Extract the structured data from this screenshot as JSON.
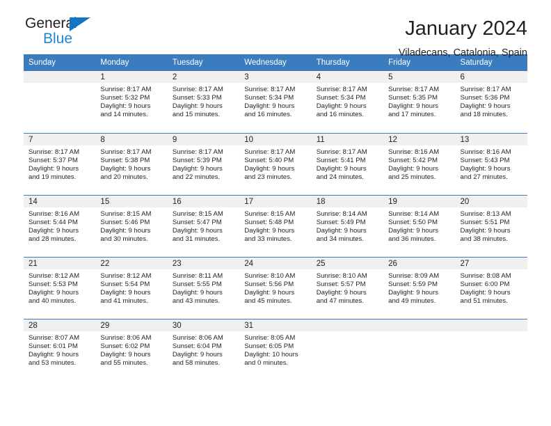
{
  "brand": {
    "name_top": "General",
    "name_bottom": "Blue",
    "triangle_icon": "triangle-icon",
    "accent_color": "#1275c4",
    "blue_text_color": "#1b87d8"
  },
  "header": {
    "title": "January 2024",
    "subtitle": "Viladecans, Catalonia, Spain"
  },
  "theme": {
    "header_row_bg": "#3b7cbe",
    "daynum_band_bg": "#f0f0f0",
    "row_border": "#3b7cbe",
    "text": "#231f20"
  },
  "calendar": {
    "weekday_headers": [
      "Sunday",
      "Monday",
      "Tuesday",
      "Wednesday",
      "Thursday",
      "Friday",
      "Saturday"
    ],
    "weeks": [
      [
        {
          "day": "",
          "sunrise": "",
          "sunset": "",
          "daylight_line1": "",
          "daylight_line2": ""
        },
        {
          "day": "1",
          "sunrise": "Sunrise: 8:17 AM",
          "sunset": "Sunset: 5:32 PM",
          "daylight_line1": "Daylight: 9 hours",
          "daylight_line2": "and 14 minutes."
        },
        {
          "day": "2",
          "sunrise": "Sunrise: 8:17 AM",
          "sunset": "Sunset: 5:33 PM",
          "daylight_line1": "Daylight: 9 hours",
          "daylight_line2": "and 15 minutes."
        },
        {
          "day": "3",
          "sunrise": "Sunrise: 8:17 AM",
          "sunset": "Sunset: 5:34 PM",
          "daylight_line1": "Daylight: 9 hours",
          "daylight_line2": "and 16 minutes."
        },
        {
          "day": "4",
          "sunrise": "Sunrise: 8:17 AM",
          "sunset": "Sunset: 5:34 PM",
          "daylight_line1": "Daylight: 9 hours",
          "daylight_line2": "and 16 minutes."
        },
        {
          "day": "5",
          "sunrise": "Sunrise: 8:17 AM",
          "sunset": "Sunset: 5:35 PM",
          "daylight_line1": "Daylight: 9 hours",
          "daylight_line2": "and 17 minutes."
        },
        {
          "day": "6",
          "sunrise": "Sunrise: 8:17 AM",
          "sunset": "Sunset: 5:36 PM",
          "daylight_line1": "Daylight: 9 hours",
          "daylight_line2": "and 18 minutes."
        }
      ],
      [
        {
          "day": "7",
          "sunrise": "Sunrise: 8:17 AM",
          "sunset": "Sunset: 5:37 PM",
          "daylight_line1": "Daylight: 9 hours",
          "daylight_line2": "and 19 minutes."
        },
        {
          "day": "8",
          "sunrise": "Sunrise: 8:17 AM",
          "sunset": "Sunset: 5:38 PM",
          "daylight_line1": "Daylight: 9 hours",
          "daylight_line2": "and 20 minutes."
        },
        {
          "day": "9",
          "sunrise": "Sunrise: 8:17 AM",
          "sunset": "Sunset: 5:39 PM",
          "daylight_line1": "Daylight: 9 hours",
          "daylight_line2": "and 22 minutes."
        },
        {
          "day": "10",
          "sunrise": "Sunrise: 8:17 AM",
          "sunset": "Sunset: 5:40 PM",
          "daylight_line1": "Daylight: 9 hours",
          "daylight_line2": "and 23 minutes."
        },
        {
          "day": "11",
          "sunrise": "Sunrise: 8:17 AM",
          "sunset": "Sunset: 5:41 PM",
          "daylight_line1": "Daylight: 9 hours",
          "daylight_line2": "and 24 minutes."
        },
        {
          "day": "12",
          "sunrise": "Sunrise: 8:16 AM",
          "sunset": "Sunset: 5:42 PM",
          "daylight_line1": "Daylight: 9 hours",
          "daylight_line2": "and 25 minutes."
        },
        {
          "day": "13",
          "sunrise": "Sunrise: 8:16 AM",
          "sunset": "Sunset: 5:43 PM",
          "daylight_line1": "Daylight: 9 hours",
          "daylight_line2": "and 27 minutes."
        }
      ],
      [
        {
          "day": "14",
          "sunrise": "Sunrise: 8:16 AM",
          "sunset": "Sunset: 5:44 PM",
          "daylight_line1": "Daylight: 9 hours",
          "daylight_line2": "and 28 minutes."
        },
        {
          "day": "15",
          "sunrise": "Sunrise: 8:15 AM",
          "sunset": "Sunset: 5:46 PM",
          "daylight_line1": "Daylight: 9 hours",
          "daylight_line2": "and 30 minutes."
        },
        {
          "day": "16",
          "sunrise": "Sunrise: 8:15 AM",
          "sunset": "Sunset: 5:47 PM",
          "daylight_line1": "Daylight: 9 hours",
          "daylight_line2": "and 31 minutes."
        },
        {
          "day": "17",
          "sunrise": "Sunrise: 8:15 AM",
          "sunset": "Sunset: 5:48 PM",
          "daylight_line1": "Daylight: 9 hours",
          "daylight_line2": "and 33 minutes."
        },
        {
          "day": "18",
          "sunrise": "Sunrise: 8:14 AM",
          "sunset": "Sunset: 5:49 PM",
          "daylight_line1": "Daylight: 9 hours",
          "daylight_line2": "and 34 minutes."
        },
        {
          "day": "19",
          "sunrise": "Sunrise: 8:14 AM",
          "sunset": "Sunset: 5:50 PM",
          "daylight_line1": "Daylight: 9 hours",
          "daylight_line2": "and 36 minutes."
        },
        {
          "day": "20",
          "sunrise": "Sunrise: 8:13 AM",
          "sunset": "Sunset: 5:51 PM",
          "daylight_line1": "Daylight: 9 hours",
          "daylight_line2": "and 38 minutes."
        }
      ],
      [
        {
          "day": "21",
          "sunrise": "Sunrise: 8:12 AM",
          "sunset": "Sunset: 5:53 PM",
          "daylight_line1": "Daylight: 9 hours",
          "daylight_line2": "and 40 minutes."
        },
        {
          "day": "22",
          "sunrise": "Sunrise: 8:12 AM",
          "sunset": "Sunset: 5:54 PM",
          "daylight_line1": "Daylight: 9 hours",
          "daylight_line2": "and 41 minutes."
        },
        {
          "day": "23",
          "sunrise": "Sunrise: 8:11 AM",
          "sunset": "Sunset: 5:55 PM",
          "daylight_line1": "Daylight: 9 hours",
          "daylight_line2": "and 43 minutes."
        },
        {
          "day": "24",
          "sunrise": "Sunrise: 8:10 AM",
          "sunset": "Sunset: 5:56 PM",
          "daylight_line1": "Daylight: 9 hours",
          "daylight_line2": "and 45 minutes."
        },
        {
          "day": "25",
          "sunrise": "Sunrise: 8:10 AM",
          "sunset": "Sunset: 5:57 PM",
          "daylight_line1": "Daylight: 9 hours",
          "daylight_line2": "and 47 minutes."
        },
        {
          "day": "26",
          "sunrise": "Sunrise: 8:09 AM",
          "sunset": "Sunset: 5:59 PM",
          "daylight_line1": "Daylight: 9 hours",
          "daylight_line2": "and 49 minutes."
        },
        {
          "day": "27",
          "sunrise": "Sunrise: 8:08 AM",
          "sunset": "Sunset: 6:00 PM",
          "daylight_line1": "Daylight: 9 hours",
          "daylight_line2": "and 51 minutes."
        }
      ],
      [
        {
          "day": "28",
          "sunrise": "Sunrise: 8:07 AM",
          "sunset": "Sunset: 6:01 PM",
          "daylight_line1": "Daylight: 9 hours",
          "daylight_line2": "and 53 minutes."
        },
        {
          "day": "29",
          "sunrise": "Sunrise: 8:06 AM",
          "sunset": "Sunset: 6:02 PM",
          "daylight_line1": "Daylight: 9 hours",
          "daylight_line2": "and 55 minutes."
        },
        {
          "day": "30",
          "sunrise": "Sunrise: 8:06 AM",
          "sunset": "Sunset: 6:04 PM",
          "daylight_line1": "Daylight: 9 hours",
          "daylight_line2": "and 58 minutes."
        },
        {
          "day": "31",
          "sunrise": "Sunrise: 8:05 AM",
          "sunset": "Sunset: 6:05 PM",
          "daylight_line1": "Daylight: 10 hours",
          "daylight_line2": "and 0 minutes."
        },
        {
          "day": "",
          "sunrise": "",
          "sunset": "",
          "daylight_line1": "",
          "daylight_line2": ""
        },
        {
          "day": "",
          "sunrise": "",
          "sunset": "",
          "daylight_line1": "",
          "daylight_line2": ""
        },
        {
          "day": "",
          "sunrise": "",
          "sunset": "",
          "daylight_line1": "",
          "daylight_line2": ""
        }
      ]
    ]
  }
}
